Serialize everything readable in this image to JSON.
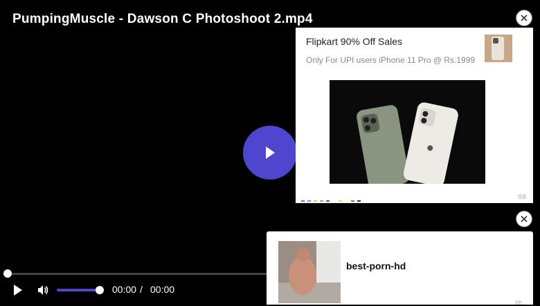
{
  "video": {
    "title": "PumpingMuscle - Dawson C Photoshoot 2.mp4",
    "current_time": "00:00",
    "separator": "/",
    "duration": "00:00",
    "progress": 0,
    "volume": 1
  },
  "ad_top": {
    "title": "Flipkart 90% Off Sales",
    "description": "Only For UPI users iPhone 11 Pro @ Rs.1999",
    "corner_label": "l58"
  },
  "ad_bottom": {
    "label": "best-porn-hd",
    "corner_label": "hh"
  },
  "colors": {
    "accent": "#4f46cf",
    "background": "#000000",
    "ad_background": "#ffffff"
  }
}
